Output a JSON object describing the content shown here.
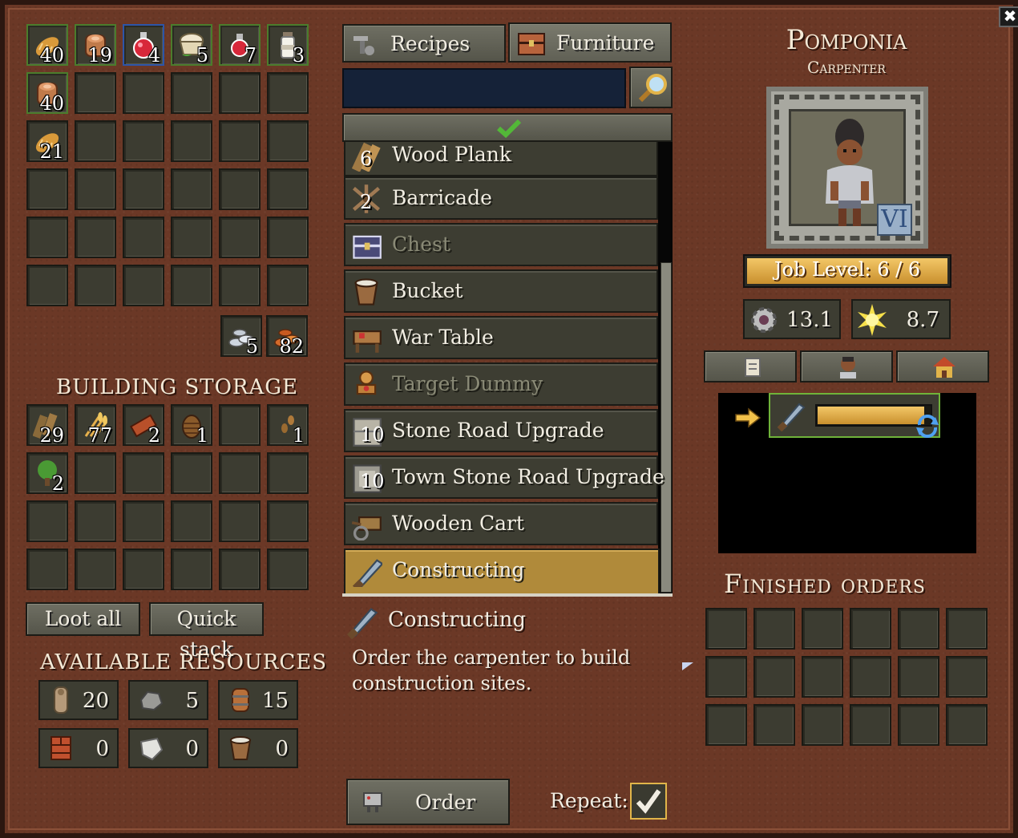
{
  "inventory": {
    "items": [
      {
        "icon": "bread-icon",
        "count": "40"
      },
      {
        "icon": "meat-barrel-icon",
        "count": "19"
      },
      {
        "icon": "red-potion-icon",
        "count": "4"
      },
      {
        "icon": "flour-sack-icon",
        "count": "5"
      },
      {
        "icon": "small-potion-icon",
        "count": "7"
      },
      {
        "icon": "milk-bottle-icon",
        "count": "3"
      },
      {
        "icon": "meat-barrel-icon",
        "count": "40"
      },
      {
        "icon": "bread-icon",
        "count": "21"
      }
    ],
    "extra": [
      {
        "icon": "silver-coins-icon",
        "count": "5"
      },
      {
        "icon": "copper-coins-icon",
        "count": "82"
      }
    ]
  },
  "building_storage": {
    "title": "BUILDING STORAGE",
    "items": [
      {
        "icon": "wood-logs-icon",
        "count": "29"
      },
      {
        "icon": "wheat-icon",
        "count": "77"
      },
      {
        "icon": "brick-icon",
        "count": "2"
      },
      {
        "icon": "pinecone-icon",
        "count": "1"
      },
      {
        "icon": "seeds-icon",
        "count": "1"
      },
      {
        "icon": "tree-sapling-icon",
        "count": "2"
      }
    ],
    "loot_all": "Loot all",
    "quick_stack": "Quick stack"
  },
  "available_resources": {
    "title": "AVAILABLE RESOURCES",
    "items": [
      {
        "icon": "log-icon",
        "value": "20"
      },
      {
        "icon": "stone-icon",
        "value": "5"
      },
      {
        "icon": "barrel-icon",
        "value": "15"
      },
      {
        "icon": "brick-block-icon",
        "value": "0"
      },
      {
        "icon": "marble-icon",
        "value": "0"
      },
      {
        "icon": "bucket-icon",
        "value": "0"
      }
    ]
  },
  "tabs": {
    "recipes": "Recipes",
    "furniture": "Furniture"
  },
  "search": {
    "value": "",
    "placeholder": ""
  },
  "recipes": [
    {
      "label": "Wood Plank",
      "count": "6",
      "state": "normal",
      "icon": "wood-plank-icon"
    },
    {
      "label": "Barricade",
      "count": "2",
      "state": "normal",
      "icon": "barricade-icon"
    },
    {
      "label": "Chest",
      "count": "",
      "state": "dim",
      "icon": "chest-icon"
    },
    {
      "label": "Bucket",
      "count": "",
      "state": "normal",
      "icon": "bucket-icon"
    },
    {
      "label": "War Table",
      "count": "",
      "state": "normal",
      "icon": "war-table-icon"
    },
    {
      "label": "Target Dummy",
      "count": "",
      "state": "dim",
      "icon": "target-dummy-icon"
    },
    {
      "label": "Stone Road Upgrade",
      "count": "10",
      "state": "normal",
      "icon": "stone-road-icon"
    },
    {
      "label": "Town Stone Road Upgrade",
      "count": "10",
      "state": "normal",
      "icon": "town-road-icon"
    },
    {
      "label": "Wooden Cart",
      "count": "",
      "state": "normal",
      "icon": "wooden-cart-icon"
    },
    {
      "label": "Constructing",
      "count": "",
      "state": "selected",
      "icon": "saw-icon"
    }
  ],
  "detail": {
    "title": "Constructing",
    "description_line1": "Order the carpenter to build",
    "description_line2": "construction sites."
  },
  "order": {
    "label": "Order",
    "repeat_label": "Repeat:",
    "repeat_checked": true
  },
  "character": {
    "name": "Pomponia",
    "job": "Carpenter",
    "rank": "VI",
    "job_level": "Job Level: 6 / 6",
    "stat1": "13.1",
    "stat2": "8.7"
  },
  "queue": {
    "progress": 0.95
  },
  "finished_orders": {
    "title": "Finished orders"
  },
  "colors": {
    "panel": "#6b3826",
    "selected": "#b08a3a",
    "gold": "#e6b04c"
  }
}
